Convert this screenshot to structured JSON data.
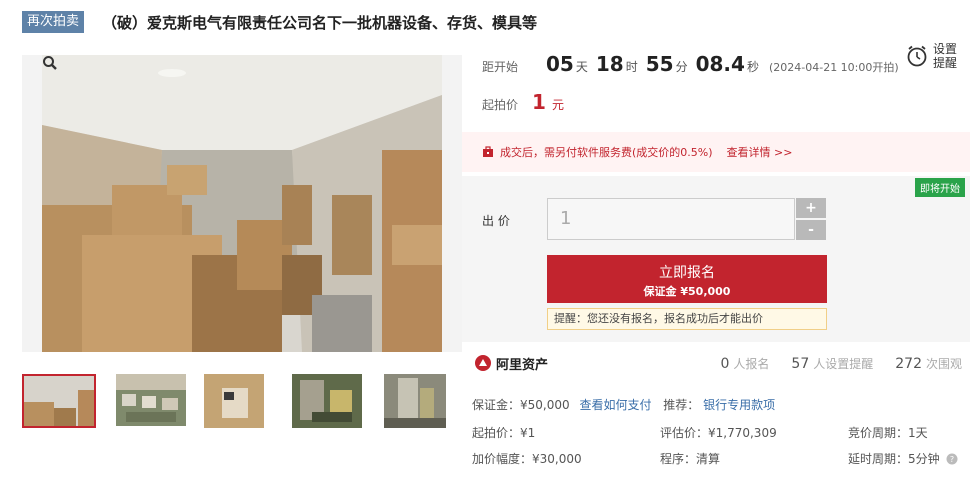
{
  "header": {
    "badge": "再次拍卖",
    "title": "（破）爱克斯电气有限责任公司名下一批机器设备、存货、模具等"
  },
  "countdown": {
    "label": "距开始",
    "days": "05",
    "days_unit": "天",
    "hours": "18",
    "hours_unit": "时",
    "minutes": "55",
    "minutes_unit": "分",
    "seconds": "08.4",
    "seconds_unit": "秒",
    "start_time": "(2024-04-21 10:00开拍)"
  },
  "setting": {
    "label": "设置提醒",
    "icon": "alarm-clock-icon"
  },
  "start_price": {
    "label": "起拍价",
    "value": "1",
    "unit": "元"
  },
  "notice": {
    "text": "成交后，需另付软件服务费(成交价的0.5%)",
    "link": "查看详情 >>"
  },
  "bid": {
    "status_badge": "即将开始",
    "label": "出  价",
    "value": "1",
    "plus": "+",
    "minus": "-",
    "signup_label": "立即报名",
    "deposit_label": "保证金 ¥50,000",
    "reminder": "提醒：您还没有报名，报名成功后才能出价"
  },
  "brand": {
    "name": "阿里资产"
  },
  "stats": [
    {
      "value": "0",
      "unit": "人报名"
    },
    {
      "value": "57",
      "unit": "人设置提醒"
    },
    {
      "value": "272",
      "unit": "次围观"
    }
  ],
  "info": {
    "deposit": "保证金：¥50,000",
    "how_to_pay": "查看如何支付",
    "recommend_label": "推荐：",
    "recommend_link": "银行专用款项",
    "start_price": "起拍价：¥1",
    "appraisal": "评估价：¥1,770,309",
    "cycle": "竞价周期：1天",
    "increment": "加价幅度：¥30,000",
    "procedure": "程序：清算",
    "delay": "延时周期：5分钟"
  },
  "colors": {
    "accent": "#c2242e",
    "badge": "#5e82a8",
    "status_green": "#2aa34a",
    "link": "#3a6ea8"
  }
}
